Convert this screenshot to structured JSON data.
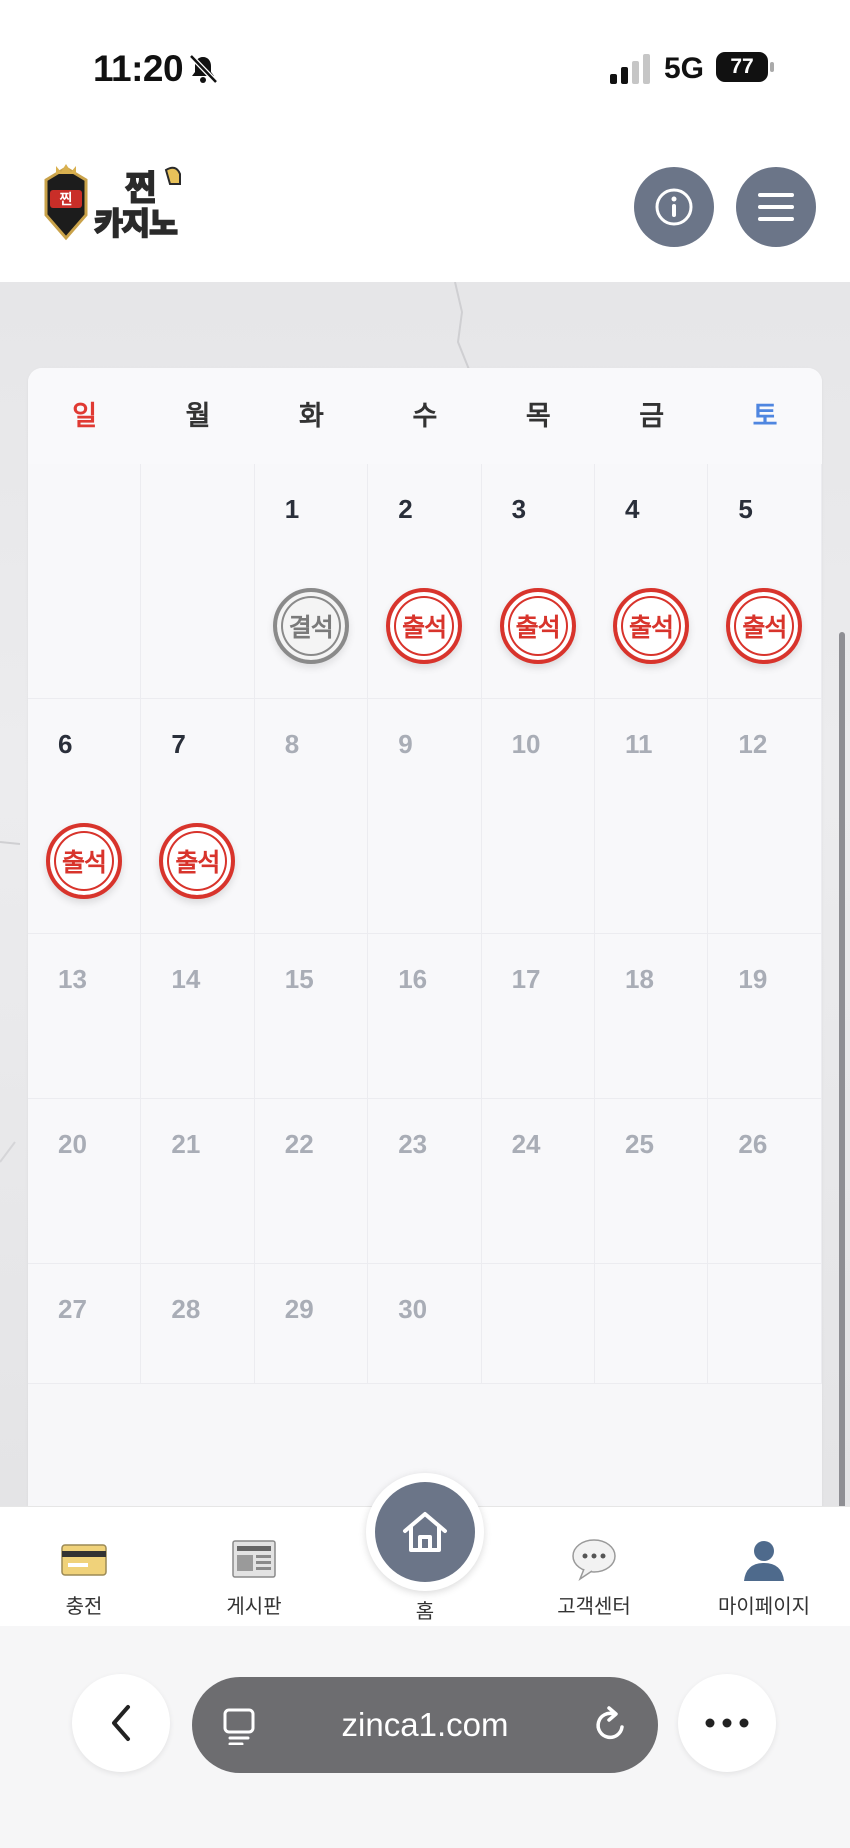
{
  "status": {
    "time": "11:20",
    "network": "5G",
    "battery": "77"
  },
  "header": {
    "logo_text_top": "찐",
    "logo_text_bottom": "카지노"
  },
  "calendar": {
    "weekdays": [
      "일",
      "월",
      "화",
      "수",
      "목",
      "금",
      "토"
    ],
    "stamp_present": "출석",
    "stamp_absent": "결석",
    "weeks": [
      [
        {
          "d": ""
        },
        {
          "d": ""
        },
        {
          "d": "1",
          "s": "absent"
        },
        {
          "d": "2",
          "s": "present"
        },
        {
          "d": "3",
          "s": "present"
        },
        {
          "d": "4",
          "s": "present"
        },
        {
          "d": "5",
          "s": "present"
        }
      ],
      [
        {
          "d": "6",
          "s": "present"
        },
        {
          "d": "7",
          "s": "present"
        },
        {
          "d": "8"
        },
        {
          "d": "9"
        },
        {
          "d": "10"
        },
        {
          "d": "11"
        },
        {
          "d": "12"
        }
      ],
      [
        {
          "d": "13"
        },
        {
          "d": "14"
        },
        {
          "d": "15"
        },
        {
          "d": "16"
        },
        {
          "d": "17"
        },
        {
          "d": "18"
        },
        {
          "d": "19"
        }
      ],
      [
        {
          "d": "20"
        },
        {
          "d": "21"
        },
        {
          "d": "22"
        },
        {
          "d": "23"
        },
        {
          "d": "24"
        },
        {
          "d": "25"
        },
        {
          "d": "26"
        }
      ],
      [
        {
          "d": "27"
        },
        {
          "d": "28"
        },
        {
          "d": "29"
        },
        {
          "d": "30"
        },
        {
          "d": ""
        },
        {
          "d": ""
        },
        {
          "d": ""
        }
      ]
    ]
  },
  "nav": {
    "charge": "충전",
    "board": "게시판",
    "home": "홈",
    "support": "고객센터",
    "mypage": "마이페이지"
  },
  "browser": {
    "url": "zinca1.com"
  },
  "colors": {
    "accent": "#6b7588",
    "stamp_red": "#d8342c",
    "sunday": "#e03a33",
    "saturday": "#4f86e0"
  }
}
